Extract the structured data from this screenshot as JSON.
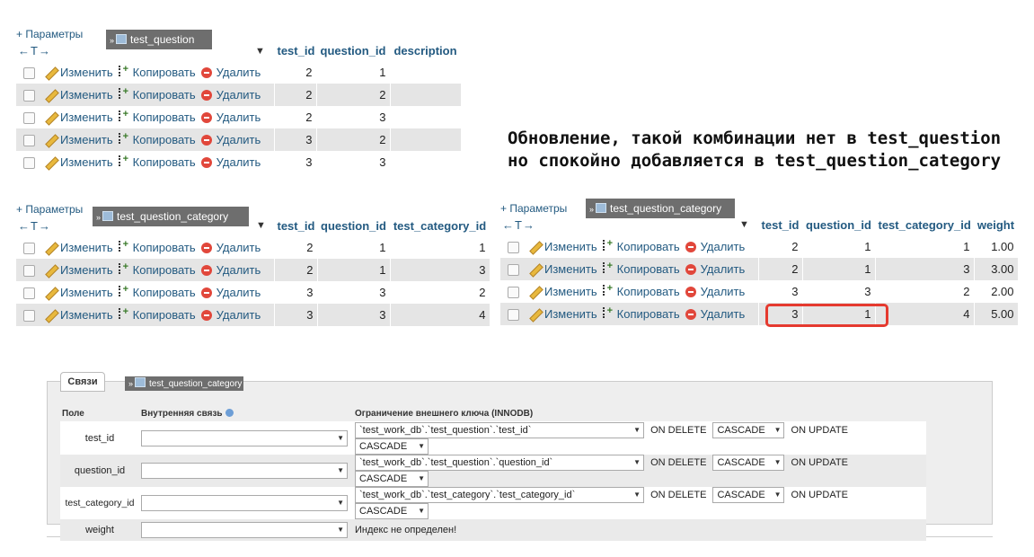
{
  "common": {
    "params_link": "+ Параметры",
    "nav_arrows": "←T→",
    "sort_arrow": "▼",
    "chevron": "»",
    "actions": {
      "edit": "Изменить",
      "copy": "Копировать",
      "delete": "Удалить"
    }
  },
  "table1": {
    "name": "test_question",
    "columns": [
      "test_id",
      "question_id",
      "description"
    ],
    "rows": [
      [
        "2",
        "1",
        ""
      ],
      [
        "2",
        "2",
        ""
      ],
      [
        "2",
        "3",
        ""
      ],
      [
        "3",
        "2",
        ""
      ],
      [
        "3",
        "3",
        ""
      ]
    ]
  },
  "annotation": {
    "line1": "Обновление, такой комбинации нет в test_question",
    "line2": "но спокойно добавляется в test_question_category"
  },
  "table2": {
    "name": "test_question_category",
    "columns": [
      "test_id",
      "question_id",
      "test_category_id"
    ],
    "rows": [
      [
        "2",
        "1",
        "1"
      ],
      [
        "2",
        "1",
        "3"
      ],
      [
        "3",
        "3",
        "2"
      ],
      [
        "3",
        "3",
        "4"
      ]
    ]
  },
  "table3": {
    "name": "test_question_category",
    "columns": [
      "test_id",
      "question_id",
      "test_category_id",
      "weight"
    ],
    "rows": [
      [
        "2",
        "1",
        "1",
        "1.00"
      ],
      [
        "2",
        "1",
        "3",
        "3.00"
      ],
      [
        "3",
        "3",
        "2",
        "2.00"
      ],
      [
        "3",
        "1",
        "4",
        "5.00"
      ]
    ]
  },
  "relations": {
    "tab_label": "Связи",
    "table_name": "test_question_category",
    "headers": {
      "field": "Поле",
      "internal": "Внутренняя связь",
      "fk": "Ограничение внешнего ключа (INNODB)"
    },
    "on_delete_label": "ON DELETE",
    "on_update_label": "ON UPDATE",
    "rows": [
      {
        "field": "test_id",
        "fk": "`test_work_db`.`test_question`.`test_id`",
        "on_delete": "CASCADE",
        "on_update": "CASCADE"
      },
      {
        "field": "question_id",
        "fk": "`test_work_db`.`test_question`.`question_id`",
        "on_delete": "CASCADE",
        "on_update": "CASCADE"
      },
      {
        "field": "test_category_id",
        "fk": "`test_work_db`.`test_category`.`test_category_id`",
        "on_delete": "CASCADE",
        "on_update": "CASCADE"
      },
      {
        "field": "weight",
        "note": "Индекс не определен!"
      }
    ]
  },
  "icons": [
    "checkbox-icon",
    "pencil-icon",
    "copy-icon",
    "delete-icon",
    "table-icon",
    "info-icon",
    "dropdown-arrow-icon"
  ],
  "colors": {
    "link": "#235a81",
    "row_alt": "#e5e5e5",
    "highlight": "#e53a2f",
    "tag_bg": "#6e6e6e"
  }
}
